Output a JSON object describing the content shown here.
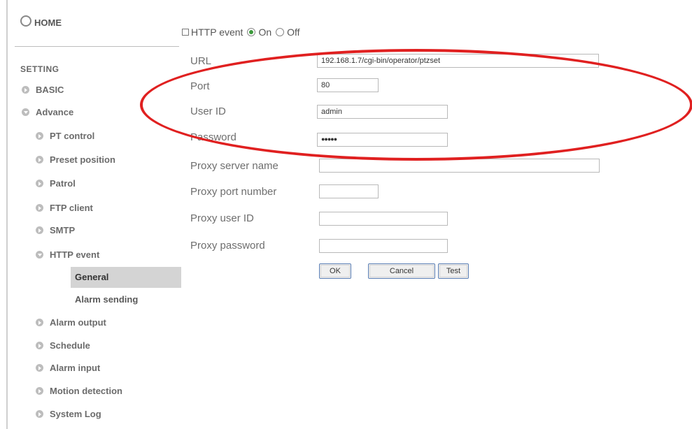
{
  "sidebar": {
    "home_label": "HOME",
    "section_label": "SETTING",
    "items": [
      {
        "label": "BASIC"
      },
      {
        "label": "Advance"
      },
      {
        "label": "PT control"
      },
      {
        "label": "Preset position"
      },
      {
        "label": "Patrol"
      },
      {
        "label": "FTP client"
      },
      {
        "label": "SMTP"
      },
      {
        "label": "HTTP event"
      },
      {
        "label": "Alarm output"
      },
      {
        "label": "Schedule"
      },
      {
        "label": "Alarm input"
      },
      {
        "label": "Motion detection"
      },
      {
        "label": "System Log"
      }
    ],
    "subitems": [
      {
        "label": "General",
        "selected": true
      },
      {
        "label": "Alarm sending"
      }
    ]
  },
  "form": {
    "title": "HTTP event",
    "radio_on": "On",
    "radio_off": "Off",
    "selected_mode": "On",
    "fields": {
      "url": {
        "label": "URL",
        "value": "192.168.1.7/cgi-bin/operator/ptzset"
      },
      "port": {
        "label": "Port",
        "value": "80"
      },
      "user_id": {
        "label": "User ID",
        "value": "admin"
      },
      "password": {
        "label": "Password",
        "value": "●●●●●"
      },
      "proxy_server": {
        "label": "Proxy server name",
        "value": ""
      },
      "proxy_port": {
        "label": "Proxy port number",
        "value": ""
      },
      "proxy_user": {
        "label": "Proxy user ID",
        "value": ""
      },
      "proxy_password": {
        "label": "Proxy password",
        "value": ""
      }
    },
    "buttons": {
      "ok": "OK",
      "cancel": "Cancel",
      "test": "Test"
    }
  },
  "annotation": {
    "color": "#e02020",
    "shape": "ellipse"
  }
}
